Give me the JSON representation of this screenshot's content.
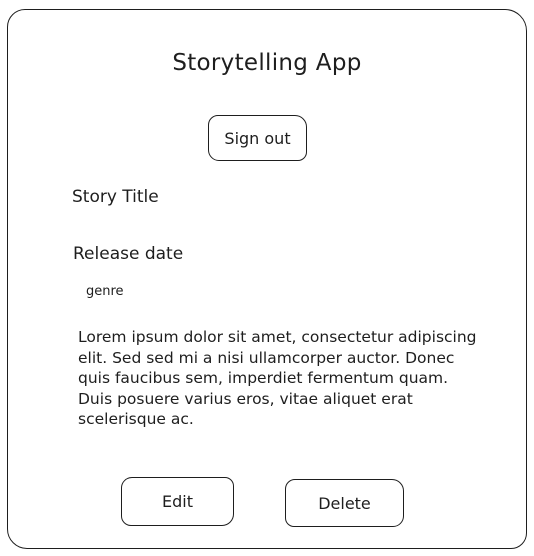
{
  "app": {
    "title": "Storytelling App"
  },
  "header": {
    "signout_label": "Sign out"
  },
  "story": {
    "title": "Story Title",
    "release_date": "Release date",
    "genre": "genre",
    "description": "Lorem ipsum dolor sit amet, consectetur adipiscing elit. Sed sed mi a nisi ullamcorper auctor. Donec quis faucibus sem, imperdiet fermentum quam. Duis posuere varius eros, vitae aliquet erat scelerisque ac."
  },
  "actions": {
    "edit_label": "Edit",
    "delete_label": "Delete"
  }
}
